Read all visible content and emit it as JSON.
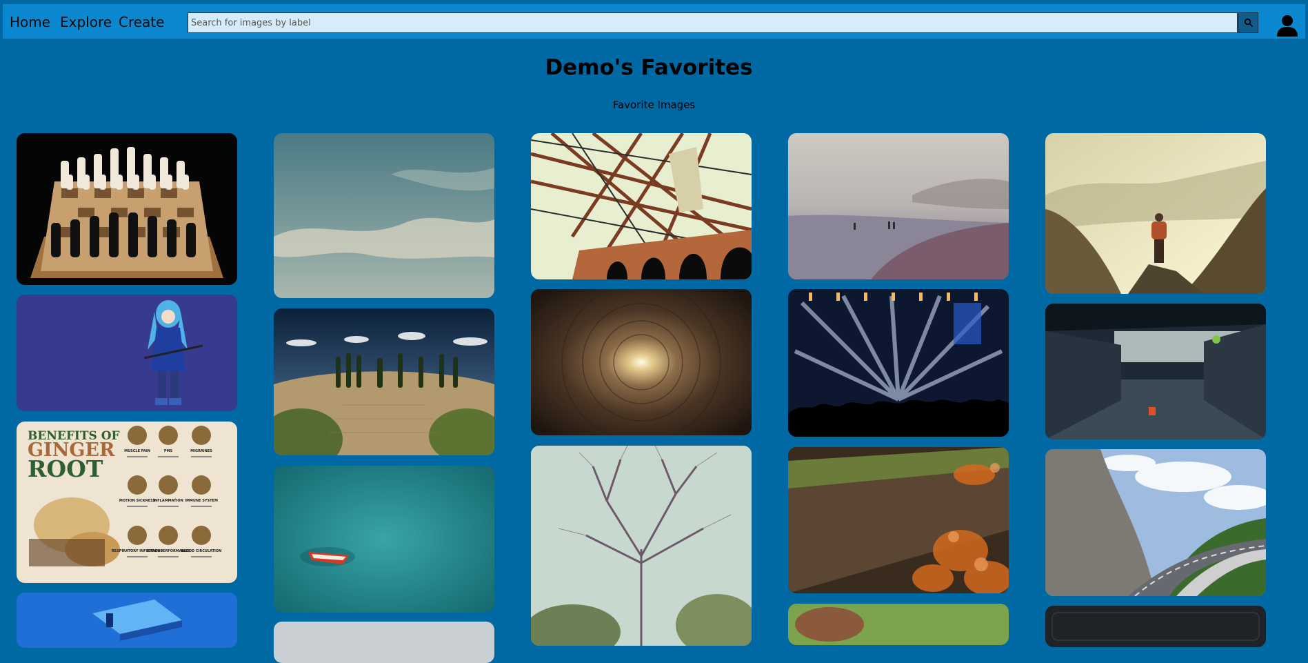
{
  "nav": {
    "home": "Home",
    "explore": "Explore",
    "create": "Create",
    "search_placeholder": "Search for images by label",
    "search_icon": "search-icon",
    "user_icon": "user-icon"
  },
  "page": {
    "title": "Demo's Favorites",
    "subtitle": "Favorite Images"
  },
  "colors": {
    "background": "#0069a3",
    "navbar": "#0b88d0",
    "search_field": "#d7ecfa",
    "search_button": "#0f5d8c"
  },
  "gallery": [
    {
      "name": "chessboard"
    },
    {
      "name": "anime-character-blue-hair"
    },
    {
      "name": "ginger-root-infographic"
    },
    {
      "name": "server-technology-illustration"
    },
    {
      "name": "cloudy-sky"
    },
    {
      "name": "tuscan-hill-cypress-trees"
    },
    {
      "name": "red-boat-on-turquoise-sea"
    },
    {
      "name": "bridge-arches"
    },
    {
      "name": "light-at-end-of-tube"
    },
    {
      "name": "bare-tree"
    },
    {
      "name": "misty-beach"
    },
    {
      "name": "concert-stage-lights"
    },
    {
      "name": "mossy-log-autumn-leaves"
    },
    {
      "name": "green-foliage"
    },
    {
      "name": "hiker-in-mountains"
    },
    {
      "name": "empty-garage-interior"
    },
    {
      "name": "mountain-road"
    },
    {
      "name": "dark-photo"
    }
  ],
  "ginger_infographic": {
    "heading_line1": "BENEFITS OF",
    "heading_line2": "GINGER",
    "heading_line3": "ROOT",
    "benefits": [
      "MUSCLE PAIN",
      "PMS",
      "MIGRAINES",
      "MOTION SICKNESS",
      "INFLAMMATION",
      "IMMUNE SYSTEM",
      "RESPIRATORY INFECTIONS",
      "BRAIN PERFORMANCE",
      "BLOOD CIRCULATION"
    ]
  }
}
